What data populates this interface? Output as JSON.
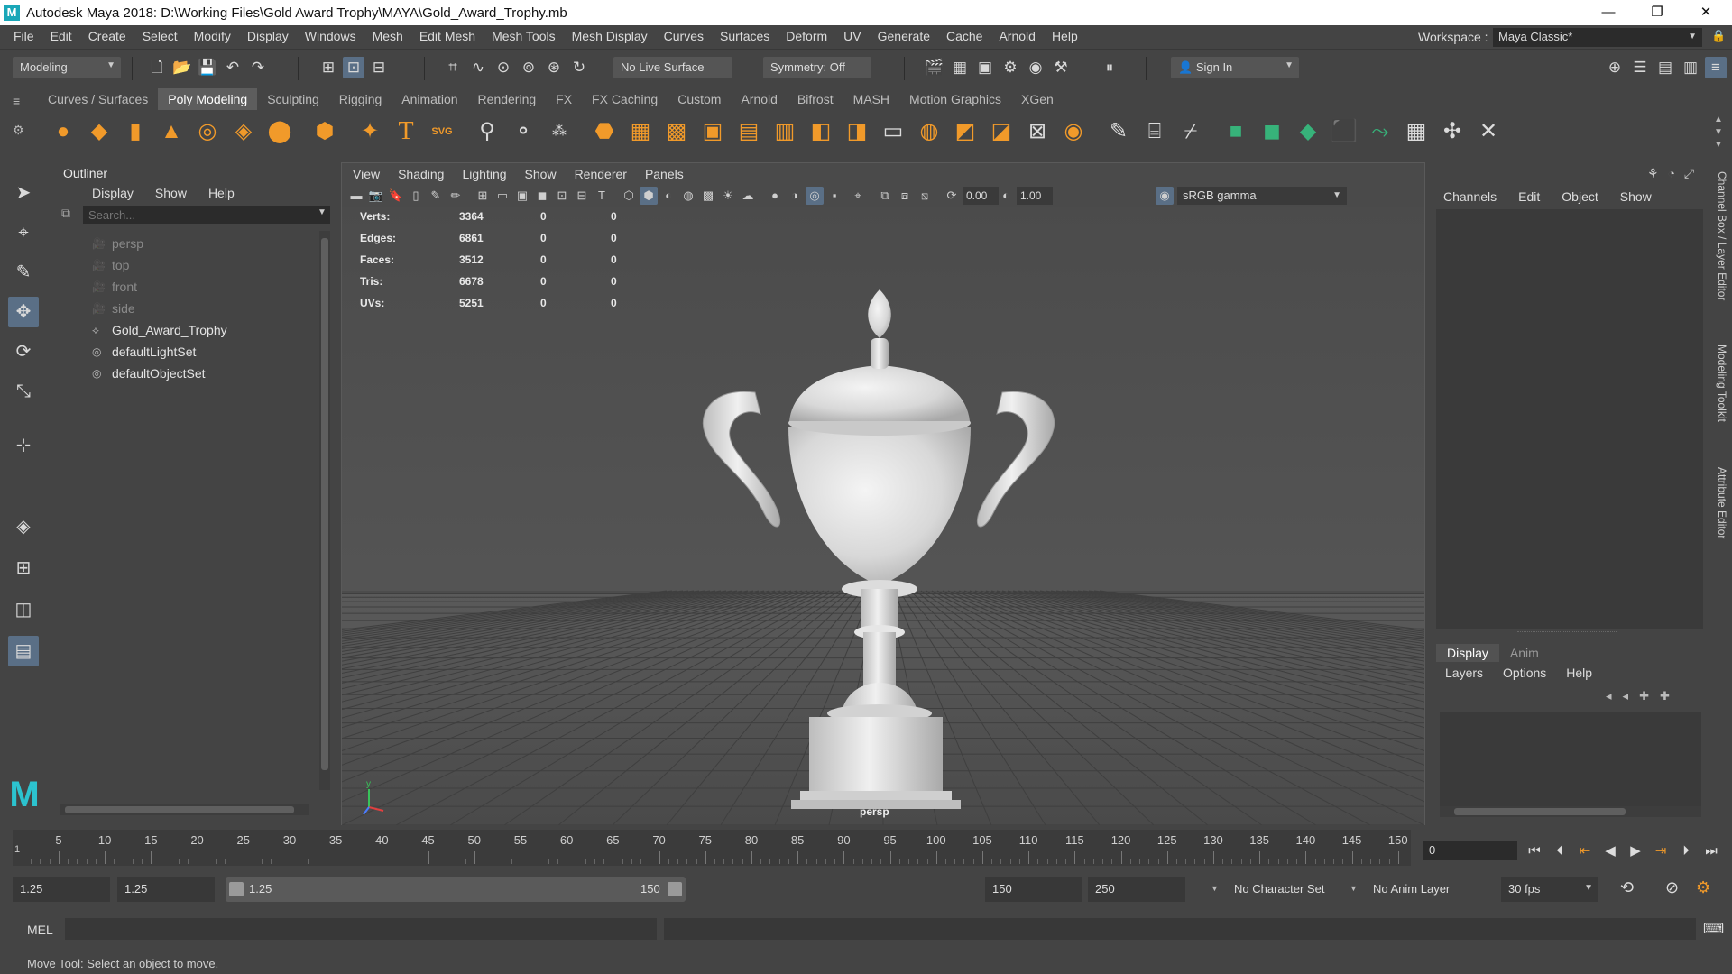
{
  "window": {
    "title": "Autodesk Maya 2018: D:\\Working Files\\Gold Award Trophy\\MAYA\\Gold_Award_Trophy.mb",
    "logo": "M",
    "minimize": "—",
    "restore": "❐",
    "close": "✕"
  },
  "menubar": {
    "items": [
      "File",
      "Edit",
      "Create",
      "Select",
      "Modify",
      "Display",
      "Windows",
      "Mesh",
      "Edit Mesh",
      "Mesh Tools",
      "Mesh Display",
      "Curves",
      "Surfaces",
      "Deform",
      "UV",
      "Generate",
      "Cache",
      "Arnold",
      "Help"
    ],
    "workspace_label": "Workspace :",
    "workspace_value": "Maya Classic*"
  },
  "statusline": {
    "mode": "Modeling",
    "live_surface": "No Live Surface",
    "symmetry": "Symmetry: Off",
    "sign_in": "Sign In"
  },
  "shelf": {
    "tabs": [
      "Curves / Surfaces",
      "Poly Modeling",
      "Sculpting",
      "Rigging",
      "Animation",
      "Rendering",
      "FX",
      "FX Caching",
      "Custom",
      "Arnold",
      "Bifrost",
      "MASH",
      "Motion Graphics",
      "XGen"
    ],
    "active_tab": "Poly Modeling",
    "svg_label": "SVG",
    "text_label": "T"
  },
  "outliner": {
    "title": "Outliner",
    "menus": [
      "Display",
      "Show",
      "Help"
    ],
    "search_placeholder": "Search...",
    "items": [
      {
        "label": "persp",
        "type": "camera"
      },
      {
        "label": "top",
        "type": "camera"
      },
      {
        "label": "front",
        "type": "camera"
      },
      {
        "label": "side",
        "type": "camera"
      },
      {
        "label": "Gold_Award_Trophy",
        "type": "mesh"
      },
      {
        "label": "defaultLightSet",
        "type": "set"
      },
      {
        "label": "defaultObjectSet",
        "type": "set"
      }
    ]
  },
  "viewport": {
    "menus": [
      "View",
      "Shading",
      "Lighting",
      "Show",
      "Renderer",
      "Panels"
    ],
    "exposure": "0.00",
    "gamma": "1.00",
    "color_space": "sRGB gamma",
    "camera": "persp",
    "hud": [
      {
        "label": "Verts:",
        "v1": "3364",
        "v2": "0",
        "v3": "0"
      },
      {
        "label": "Edges:",
        "v1": "6861",
        "v2": "0",
        "v3": "0"
      },
      {
        "label": "Faces:",
        "v1": "3512",
        "v2": "0",
        "v3": "0"
      },
      {
        "label": "Tris:",
        "v1": "6678",
        "v2": "0",
        "v3": "0"
      },
      {
        "label": "UVs:",
        "v1": "5251",
        "v2": "0",
        "v3": "0"
      }
    ],
    "axis": {
      "x": "x",
      "y": "y",
      "z": "z"
    }
  },
  "channelbox": {
    "menus": [
      "Channels",
      "Edit",
      "Object",
      "Show"
    ],
    "layer_tabs": [
      "Display",
      "Anim"
    ],
    "active_layer_tab": "Display",
    "layer_menus": [
      "Layers",
      "Options",
      "Help"
    ],
    "side_tabs": [
      "Channel Box / Layer Editor",
      "Modeling Toolkit",
      "Attribute Editor"
    ]
  },
  "timeslider": {
    "ticks": [
      "5",
      "10",
      "15",
      "20",
      "25",
      "30",
      "35",
      "40",
      "45",
      "50",
      "55",
      "60",
      "65",
      "70",
      "75",
      "80",
      "85",
      "90",
      "95",
      "100",
      "105",
      "110",
      "115",
      "120",
      "125",
      "130",
      "135",
      "140",
      "145",
      "150"
    ],
    "current_frame": "0",
    "start_marker": "1"
  },
  "rangeslider": {
    "start_time": "1.25",
    "playback_start": "1.25",
    "range_start": "1.25",
    "range_end": "150",
    "playback_end": "150",
    "end_time": "250",
    "character_set": "No Character Set",
    "anim_layer": "No Anim Layer",
    "fps": "30 fps"
  },
  "commandline": {
    "label": "MEL"
  },
  "helpline": {
    "text": "Move Tool: Select an object to move."
  },
  "colors": {
    "accent": "#5a6f86",
    "maya_teal": "#2cc3cf",
    "shelf_orange": "#f19a2a",
    "shelf_green": "#37b37a",
    "viewport_bg": "#4a4a4a"
  }
}
